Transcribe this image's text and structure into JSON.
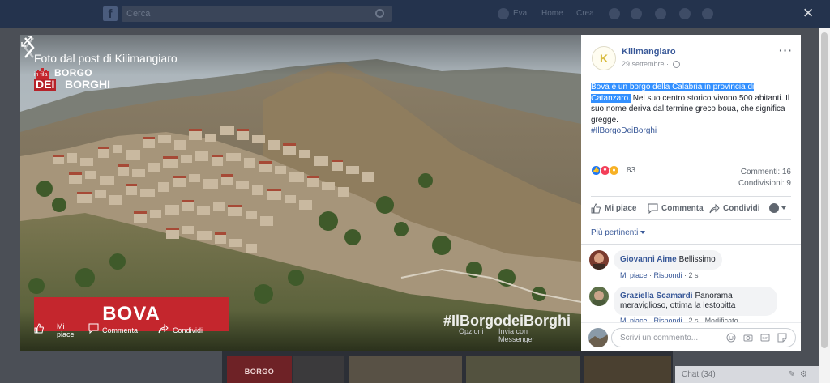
{
  "topbar": {
    "search_placeholder": "Cerca",
    "nav_name": "Eva",
    "nav_home": "Home",
    "nav_find": "Crea"
  },
  "close_label": "×",
  "photo": {
    "title": "Foto dal post di Kilimangiaro",
    "logo_inf": "in fila",
    "logo_borgo": "BORGO",
    "logo_dei": "DEI",
    "logo_borghi": "BORGHI",
    "banner": "BOVA",
    "hashtag_watermark": "#IlBorgodeiBorghi",
    "actions": {
      "like": "Mi piace",
      "comment": "Commenta",
      "share": "Condividi",
      "options": "Opzioni",
      "send": "Invia con Messenger"
    }
  },
  "post": {
    "author": "Kilimangiaro",
    "avatar_letter": "K",
    "date": "29 settembre · ",
    "text_highlighted": "Bova è un borgo della Calabria in provincia di Catanzaro.",
    "text_rest": " Nel suo centro storico vivono 500 abitanti. Il suo nome deriva dal termine greco boua, che significa gregge.",
    "hashtag": "#IlBorgoDeiBorghi",
    "reaction_count": "83",
    "comments_stat": "Commenti: 16",
    "shares_stat": "Condivisioni: 9",
    "actions": {
      "like": "Mi piace",
      "comment": "Commenta",
      "share": "Condividi"
    },
    "sort_label": "Più pertinenti"
  },
  "comments": [
    {
      "author": "Giovanni Aime",
      "text": "Bellissimo",
      "like": "Mi piace",
      "reply": "Rispondi",
      "time": "2 s"
    },
    {
      "author": "Graziella Scamardi",
      "text": "Panorama meraviglioso, ottima la lestopitta",
      "like": "Mi piace",
      "reply": "Rispondi",
      "time": "2 s",
      "edited": "Modificato"
    }
  ],
  "composer": {
    "placeholder": "Scrivi un commento..."
  },
  "chat": {
    "label": "Chat (34)"
  },
  "colors": {
    "fb_blue": "#385898",
    "banner_red": "#c4262d",
    "highlight": "#3390ff"
  }
}
